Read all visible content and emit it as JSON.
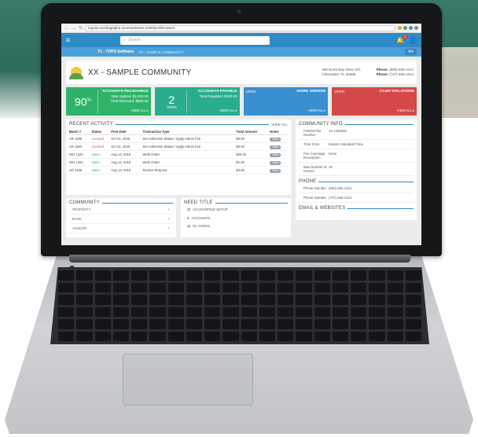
{
  "browser": {
    "url": "topsaccountingalpha.azurewebsites.net/#/profile/view/4"
  },
  "app": {
    "search_placeholder": "Search",
    "notification_count": "2",
    "brand": "T1 - TOPS Software",
    "breadcrumb": "XX - SAMPLE COMMUNITY",
    "settings_label": "⚙▾"
  },
  "header": {
    "title": "XX - SAMPLE COMMUNITY",
    "address_line1": "456 North Bay Drive 221",
    "address_line2": "Clearwater, FL 34565",
    "phone_label": "Phone:",
    "phone": "(800) 555-1212",
    "fax_label": "Phone:",
    "fax": "(727) 555-1213"
  },
  "cards": {
    "receivable": {
      "big": "90",
      "big_suffix": "%",
      "title": "ACCOUNTS RECEIVABLE",
      "line1": "Total Applied: $1,000.00",
      "line2": "Total Received: $900.00",
      "view_all": "VIEW ALL ▸"
    },
    "payable": {
      "big": "2",
      "small": "OPEN",
      "title": "ACCOUNTS PAYABLE",
      "line1": "Total Payables: $100.00",
      "view_all": "VIEW ALL ▸"
    },
    "work_orders": {
      "status": "OPEN",
      "title": "WORK ORDERS",
      "view_all": "VIEW ALL ▸"
    },
    "violations": {
      "status": "OPEN",
      "title": "CC&R VIOLATIONS",
      "view_all": "VIEW ALL ▸"
    },
    "colors": {
      "green": "#2fb36a",
      "teal": "#2aad8e",
      "blue": "#3a8fd0",
      "red": "#d54848"
    }
  },
  "activity": {
    "title": "RECENT ACTIVITY",
    "view_all": "VIEW ALL",
    "columns": [
      "Batch #",
      "Status",
      "Post Date",
      "Transaction Type",
      "Total Amount",
      "Notes"
    ],
    "rows": [
      {
        "batch": "AR 1185",
        "status": "Accrued",
        "date": "Oct 31, 2015",
        "type": "Set Collection Status / Apply Admin Fee",
        "amount": "$0.00",
        "notes": "View"
      },
      {
        "batch": "AR 1184",
        "status": "Accrued",
        "date": "Oct 31, 2015",
        "type": "Set Collection Status / Apply Admin Fee",
        "amount": "$0.00",
        "notes": "View"
      },
      {
        "batch": "WO 1224",
        "status": "Open",
        "date": "Aug 13, 2015",
        "type": "Work Order",
        "amount": "$25.00",
        "notes": "View"
      },
      {
        "batch": "WO 1201",
        "status": "Open",
        "date": "Aug 13, 2015",
        "type": "Work Order",
        "amount": "$1.00",
        "notes": "View"
      },
      {
        "batch": "SO 1188",
        "status": "Open",
        "date": "Aug 13, 2015",
        "type": "Service Request",
        "amount": "$3.00",
        "notes": "View"
      }
    ]
  },
  "community_info": {
    "title": "COMMUNITY INFO",
    "fields": [
      {
        "k": "Federal Tax Number",
        "v": "12-1454545"
      },
      {
        "k": "Time Zone",
        "v": "Eastern Standard Time"
      },
      {
        "k": "Fee Coverage Description",
        "v": "None"
      },
      {
        "k": "Max Number of Homes",
        "v": "10"
      }
    ],
    "phone_title": "PHONE",
    "phones": [
      {
        "k": "Phone Number",
        "v": "(800) 555-1212"
      },
      {
        "k": "Phone Number",
        "v": "(727) 555-1213"
      }
    ],
    "email_title": "EMAIL & WEBSITES"
  },
  "community": {
    "title": "COMMUNITY",
    "items": [
      "PROPERTY",
      "BANK",
      "VENDOR"
    ],
    "add_symbol": "+"
  },
  "need_title": {
    "title": "NEED TITLE",
    "items": [
      {
        "icon": "▤",
        "label": "ACCOUNTING SETUP"
      },
      {
        "icon": "$",
        "label": "ACCOUNTS"
      },
      {
        "icon": "▥",
        "label": "GL CODES"
      }
    ]
  }
}
